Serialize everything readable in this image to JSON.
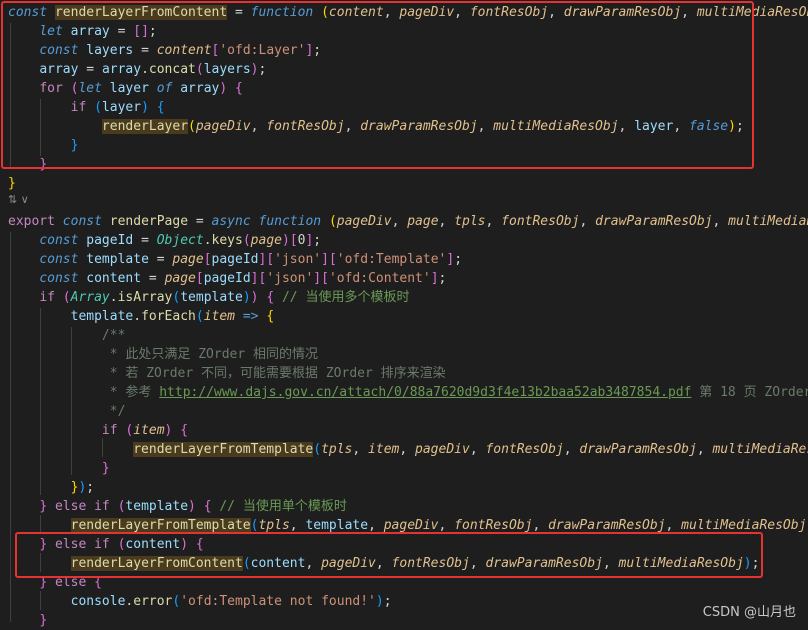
{
  "editor": {
    "lines": [
      [
        [
          "kw",
          "const "
        ],
        [
          "def",
          "renderLayerFromContent"
        ],
        [
          "plain",
          " = "
        ],
        [
          "kw",
          "function "
        ],
        [
          "b1",
          "("
        ],
        [
          "param",
          "content"
        ],
        [
          "plain",
          ", "
        ],
        [
          "param",
          "pageDiv"
        ],
        [
          "plain",
          ", "
        ],
        [
          "param",
          "fontResObj"
        ],
        [
          "plain",
          ", "
        ],
        [
          "param",
          "drawParamResObj"
        ],
        [
          "plain",
          ", "
        ],
        [
          "param",
          "multiMediaResOb"
        ]
      ],
      [
        [
          "plain",
          "    "
        ],
        [
          "kw",
          "let "
        ],
        [
          "var",
          "array"
        ],
        [
          "plain",
          " = "
        ],
        [
          "b2",
          "[]"
        ],
        [
          "plain",
          ";"
        ]
      ],
      [
        [
          "plain",
          "    "
        ],
        [
          "kw",
          "const "
        ],
        [
          "var",
          "layers"
        ],
        [
          "plain",
          " = "
        ],
        [
          "param",
          "content"
        ],
        [
          "b2",
          "["
        ],
        [
          "str",
          "'ofd:Layer'"
        ],
        [
          "b2",
          "]"
        ],
        [
          "plain",
          ";"
        ]
      ],
      [
        [
          "plain",
          "    "
        ],
        [
          "var",
          "array"
        ],
        [
          "plain",
          " = "
        ],
        [
          "var",
          "array"
        ],
        [
          "plain",
          "."
        ],
        [
          "fn",
          "concat"
        ],
        [
          "b2",
          "("
        ],
        [
          "var",
          "layers"
        ],
        [
          "b2",
          ")"
        ],
        [
          "plain",
          ";"
        ]
      ],
      [
        [
          "plain",
          "    "
        ],
        [
          "ctrl",
          "for "
        ],
        [
          "b2",
          "("
        ],
        [
          "kw",
          "let "
        ],
        [
          "var",
          "layer"
        ],
        [
          "plain",
          " "
        ],
        [
          "kw",
          "of "
        ],
        [
          "var",
          "array"
        ],
        [
          "b2",
          ")"
        ],
        [
          "plain",
          " "
        ],
        [
          "b2",
          "{"
        ]
      ],
      [
        [
          "plain",
          "        "
        ],
        [
          "ctrl",
          "if "
        ],
        [
          "b3",
          "("
        ],
        [
          "var",
          "layer"
        ],
        [
          "b3",
          ")"
        ],
        [
          "plain",
          " "
        ],
        [
          "b3",
          "{"
        ]
      ],
      [
        [
          "plain",
          "            "
        ],
        [
          "fnhl",
          "renderLayer"
        ],
        [
          "b1",
          "("
        ],
        [
          "param",
          "pageDiv"
        ],
        [
          "plain",
          ", "
        ],
        [
          "param",
          "fontResObj"
        ],
        [
          "plain",
          ", "
        ],
        [
          "param",
          "drawParamResObj"
        ],
        [
          "plain",
          ", "
        ],
        [
          "param",
          "multiMediaResObj"
        ],
        [
          "plain",
          ", "
        ],
        [
          "var",
          "layer"
        ],
        [
          "plain",
          ", "
        ],
        [
          "bool",
          "false"
        ],
        [
          "b1",
          ")"
        ],
        [
          "plain",
          ";"
        ]
      ],
      [
        [
          "plain",
          "        "
        ],
        [
          "b3",
          "}"
        ]
      ],
      [
        [
          "plain",
          "    "
        ],
        [
          "b2",
          "}"
        ]
      ],
      [
        [
          "b1",
          "}"
        ]
      ],
      [
        [
          "plain",
          ""
        ]
      ],
      [
        [
          "ctrl",
          "export "
        ],
        [
          "kw",
          "const "
        ],
        [
          "fn",
          "renderPage"
        ],
        [
          "plain",
          " = "
        ],
        [
          "kw",
          "async "
        ],
        [
          "kw",
          "function "
        ],
        [
          "b1",
          "("
        ],
        [
          "param",
          "pageDiv"
        ],
        [
          "plain",
          ", "
        ],
        [
          "param",
          "page"
        ],
        [
          "plain",
          ", "
        ],
        [
          "param",
          "tpls"
        ],
        [
          "plain",
          ", "
        ],
        [
          "param",
          "fontResObj"
        ],
        [
          "plain",
          ", "
        ],
        [
          "param",
          "drawParamResObj"
        ],
        [
          "plain",
          ", "
        ],
        [
          "param",
          "multiMediaR"
        ]
      ],
      [
        [
          "plain",
          "    "
        ],
        [
          "kw",
          "const "
        ],
        [
          "var",
          "pageId"
        ],
        [
          "plain",
          " = "
        ],
        [
          "type",
          "Object"
        ],
        [
          "plain",
          "."
        ],
        [
          "fn",
          "keys"
        ],
        [
          "b2",
          "("
        ],
        [
          "param",
          "page"
        ],
        [
          "b2",
          ")"
        ],
        [
          "b2",
          "["
        ],
        [
          "plain",
          "0"
        ],
        [
          "b2",
          "]"
        ],
        [
          "plain",
          ";"
        ]
      ],
      [
        [
          "plain",
          "    "
        ],
        [
          "kw",
          "const "
        ],
        [
          "var",
          "template"
        ],
        [
          "plain",
          " = "
        ],
        [
          "param",
          "page"
        ],
        [
          "b2",
          "["
        ],
        [
          "var",
          "pageId"
        ],
        [
          "b2",
          "]"
        ],
        [
          "b2",
          "["
        ],
        [
          "str",
          "'json'"
        ],
        [
          "b2",
          "]"
        ],
        [
          "b2",
          "["
        ],
        [
          "str",
          "'ofd:Template'"
        ],
        [
          "b2",
          "]"
        ],
        [
          "plain",
          ";"
        ]
      ],
      [
        [
          "plain",
          "    "
        ],
        [
          "kw",
          "const "
        ],
        [
          "var",
          "content"
        ],
        [
          "plain",
          " = "
        ],
        [
          "param",
          "page"
        ],
        [
          "b2",
          "["
        ],
        [
          "var",
          "pageId"
        ],
        [
          "b2",
          "]"
        ],
        [
          "b2",
          "["
        ],
        [
          "str",
          "'json'"
        ],
        [
          "b2",
          "]"
        ],
        [
          "b2",
          "["
        ],
        [
          "str",
          "'ofd:Content'"
        ],
        [
          "b2",
          "]"
        ],
        [
          "plain",
          ";"
        ]
      ],
      [
        [
          "plain",
          "    "
        ],
        [
          "ctrl",
          "if "
        ],
        [
          "b2",
          "("
        ],
        [
          "type",
          "Array"
        ],
        [
          "plain",
          "."
        ],
        [
          "fn",
          "isArray"
        ],
        [
          "b3",
          "("
        ],
        [
          "var",
          "template"
        ],
        [
          "b3",
          ")"
        ],
        [
          "b2",
          ")"
        ],
        [
          "plain",
          " "
        ],
        [
          "b2",
          "{"
        ],
        [
          "plain",
          " "
        ],
        [
          "comment",
          "// 当使用多个模板时"
        ]
      ],
      [
        [
          "plain",
          "        "
        ],
        [
          "var",
          "template"
        ],
        [
          "plain",
          "."
        ],
        [
          "fn",
          "forEach"
        ],
        [
          "b3",
          "("
        ],
        [
          "param",
          "item"
        ],
        [
          "plain",
          " "
        ],
        [
          "kw",
          "=> "
        ],
        [
          "b1",
          "{"
        ]
      ],
      [
        [
          "plain",
          "            "
        ],
        [
          "commentdim",
          "/**"
        ]
      ],
      [
        [
          "plain",
          "             "
        ],
        [
          "commentdim",
          "* 此处只满足 ZOrder 相同的情况"
        ]
      ],
      [
        [
          "plain",
          "             "
        ],
        [
          "commentdim",
          "* 若 ZOrder 不同，可能需要根据 ZOrder 排序来渲染"
        ]
      ],
      [
        [
          "plain",
          "             "
        ],
        [
          "commentdim",
          "* 参考 "
        ],
        [
          "link",
          "http://www.dajs.gov.cn/attach/0/88a7620d9d3f4e13b2baa52ab3487854.pdf"
        ],
        [
          "commentdim",
          " 第 18 页 ZOrder"
        ]
      ],
      [
        [
          "plain",
          "             "
        ],
        [
          "commentdim",
          "*/"
        ]
      ],
      [
        [
          "plain",
          "            "
        ],
        [
          "ctrl",
          "if "
        ],
        [
          "b2",
          "("
        ],
        [
          "param",
          "item"
        ],
        [
          "b2",
          ")"
        ],
        [
          "plain",
          " "
        ],
        [
          "b2",
          "{"
        ]
      ],
      [
        [
          "plain",
          "                "
        ],
        [
          "fnhl",
          "renderLayerFromTemplate"
        ],
        [
          "b3",
          "("
        ],
        [
          "param",
          "tpls"
        ],
        [
          "plain",
          ", "
        ],
        [
          "param",
          "item"
        ],
        [
          "plain",
          ", "
        ],
        [
          "param",
          "pageDiv"
        ],
        [
          "plain",
          ", "
        ],
        [
          "param",
          "fontResObj"
        ],
        [
          "plain",
          ", "
        ],
        [
          "param",
          "drawParamResObj"
        ],
        [
          "plain",
          ", "
        ],
        [
          "param",
          "multiMediaRes"
        ]
      ],
      [
        [
          "plain",
          "            "
        ],
        [
          "b2",
          "}"
        ]
      ],
      [
        [
          "plain",
          "        "
        ],
        [
          "b1",
          "}"
        ],
        [
          "b3",
          ")"
        ],
        [
          "plain",
          ";"
        ]
      ],
      [
        [
          "plain",
          "    "
        ],
        [
          "b2",
          "}"
        ],
        [
          "plain",
          " "
        ],
        [
          "ctrl",
          "else if "
        ],
        [
          "b2",
          "("
        ],
        [
          "var",
          "template"
        ],
        [
          "b2",
          ")"
        ],
        [
          "plain",
          " "
        ],
        [
          "b2",
          "{"
        ],
        [
          "plain",
          " "
        ],
        [
          "comment",
          "// 当使用单个模板时"
        ]
      ],
      [
        [
          "plain",
          "        "
        ],
        [
          "fnhl",
          "renderLayerFromTemplate"
        ],
        [
          "b3",
          "("
        ],
        [
          "param",
          "tpls"
        ],
        [
          "plain",
          ", "
        ],
        [
          "var",
          "template"
        ],
        [
          "plain",
          ", "
        ],
        [
          "param",
          "pageDiv"
        ],
        [
          "plain",
          ", "
        ],
        [
          "param",
          "fontResObj"
        ],
        [
          "plain",
          ", "
        ],
        [
          "param",
          "drawParamResObj"
        ],
        [
          "plain",
          ", "
        ],
        [
          "param",
          "multiMediaResObj"
        ],
        [
          "b3",
          ")"
        ]
      ],
      [
        [
          "plain",
          "    "
        ],
        [
          "b2",
          "}"
        ],
        [
          "plain",
          " "
        ],
        [
          "ctrl",
          "else if "
        ],
        [
          "b2",
          "("
        ],
        [
          "var",
          "content"
        ],
        [
          "b2",
          ")"
        ],
        [
          "plain",
          " "
        ],
        [
          "b2",
          "{"
        ]
      ],
      [
        [
          "plain",
          "        "
        ],
        [
          "fnhl",
          "renderLayerFromContent"
        ],
        [
          "b3",
          "("
        ],
        [
          "var",
          "content"
        ],
        [
          "plain",
          ", "
        ],
        [
          "param",
          "pageDiv"
        ],
        [
          "plain",
          ", "
        ],
        [
          "param",
          "fontResObj"
        ],
        [
          "plain",
          ", "
        ],
        [
          "param",
          "drawParamResObj"
        ],
        [
          "plain",
          ", "
        ],
        [
          "param",
          "multiMediaResObj"
        ],
        [
          "b3",
          ")"
        ],
        [
          "plain",
          ";"
        ]
      ],
      [
        [
          "plain",
          "    "
        ],
        [
          "b2",
          "}"
        ],
        [
          "plain",
          " "
        ],
        [
          "ctrl",
          "else "
        ],
        [
          "b2",
          "{"
        ]
      ],
      [
        [
          "plain",
          "        "
        ],
        [
          "var",
          "console"
        ],
        [
          "plain",
          "."
        ],
        [
          "fn",
          "error"
        ],
        [
          "b3",
          "("
        ],
        [
          "str",
          "'ofd:Template not found!'"
        ],
        [
          "b3",
          ")"
        ],
        [
          "plain",
          ";"
        ]
      ],
      [
        [
          "plain",
          "    "
        ],
        [
          "b2",
          "}"
        ]
      ]
    ],
    "fold_marker": "⇅ ∨"
  },
  "watermark": "CSDN @山月也",
  "colors": {
    "background": "#1e1e1e",
    "highlight_box": "#e53333"
  }
}
